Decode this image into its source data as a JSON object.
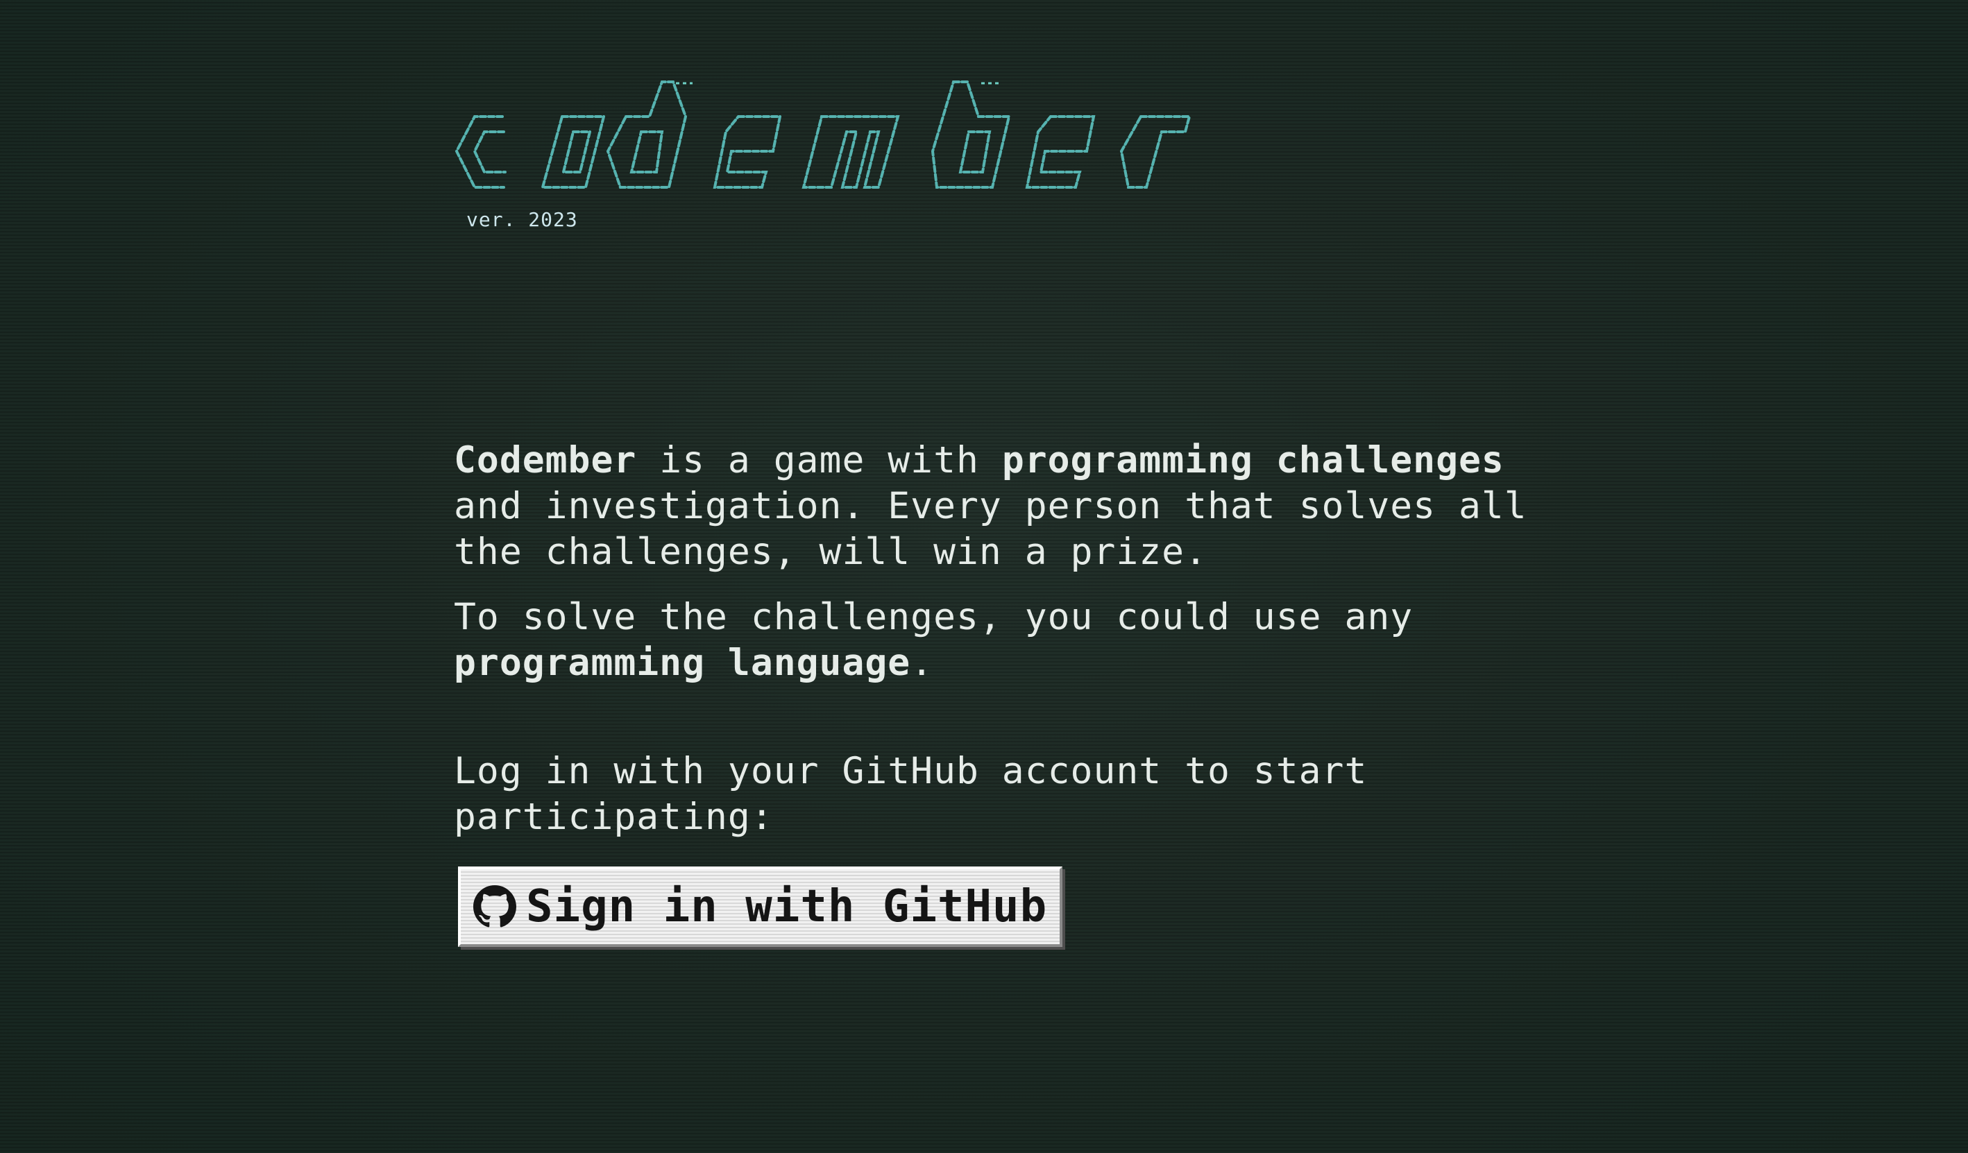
{
  "header": {
    "logo_text": "codember",
    "version": "ver. 2023"
  },
  "intro": {
    "p1_brand": "Codember",
    "p1_a": " is a game with ",
    "p1_bold": "programming challenges",
    "p1_b": " and investigation. Every person that solves all the challenges, will win a prize.",
    "p2_a": "To solve the challenges, you could use any ",
    "p2_bold": "programming language",
    "p2_b": "."
  },
  "login": {
    "text": "Log in with your GitHub account to start participating:",
    "button_label": "Sign in with GitHub",
    "button_icon": "github-icon"
  },
  "colors": {
    "background": "#1d2a24",
    "text": "#e6ece8",
    "logo": "#58b6b4",
    "button_bg": "#f1f1f1"
  }
}
